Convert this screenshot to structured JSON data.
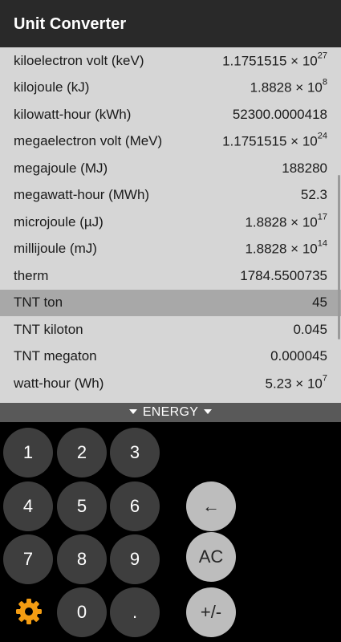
{
  "app": {
    "title": "Unit Converter"
  },
  "units": [
    {
      "name": "kiloelectron volt (keV)",
      "mantissa": "1.1751515",
      "exp": "27"
    },
    {
      "name": "kilojoule (kJ)",
      "mantissa": "1.8828",
      "exp": "8"
    },
    {
      "name": "kilowatt-hour (kWh)",
      "value": "52300.0000418"
    },
    {
      "name": "megaelectron volt (MeV)",
      "mantissa": "1.1751515",
      "exp": "24"
    },
    {
      "name": "megajoule (MJ)",
      "value": "188280"
    },
    {
      "name": "megawatt-hour (MWh)",
      "value": "52.3"
    },
    {
      "name": "microjoule (µJ)",
      "mantissa": "1.8828",
      "exp": "17"
    },
    {
      "name": "millijoule (mJ)",
      "mantissa": "1.8828",
      "exp": "14"
    },
    {
      "name": "therm",
      "value": "1784.5500735"
    },
    {
      "name": "TNT ton",
      "value": "45",
      "selected": true
    },
    {
      "name": "TNT kiloton",
      "value": "0.045"
    },
    {
      "name": "TNT megaton",
      "value": "0.000045"
    },
    {
      "name": "watt-hour (Wh)",
      "mantissa": "5.23",
      "exp": "7"
    }
  ],
  "category": {
    "label": "ENERGY"
  },
  "keypad": {
    "k1": "1",
    "k2": "2",
    "k3": "3",
    "k4": "4",
    "k5": "5",
    "k6": "6",
    "k7": "7",
    "k8": "8",
    "k9": "9",
    "k0": "0",
    "dot": ".",
    "backspace": "←",
    "clear": "AC",
    "sign": "+/-"
  },
  "icons": {
    "settings": "gear-icon"
  },
  "colors": {
    "appbar": "#292929",
    "list_bg": "#d6d6d6",
    "selected_row": "#a8a8a8",
    "category_bar": "#595959",
    "key_dark": "#3e3e3e",
    "key_light": "#bdbdbd",
    "gear": "#f39c12"
  }
}
